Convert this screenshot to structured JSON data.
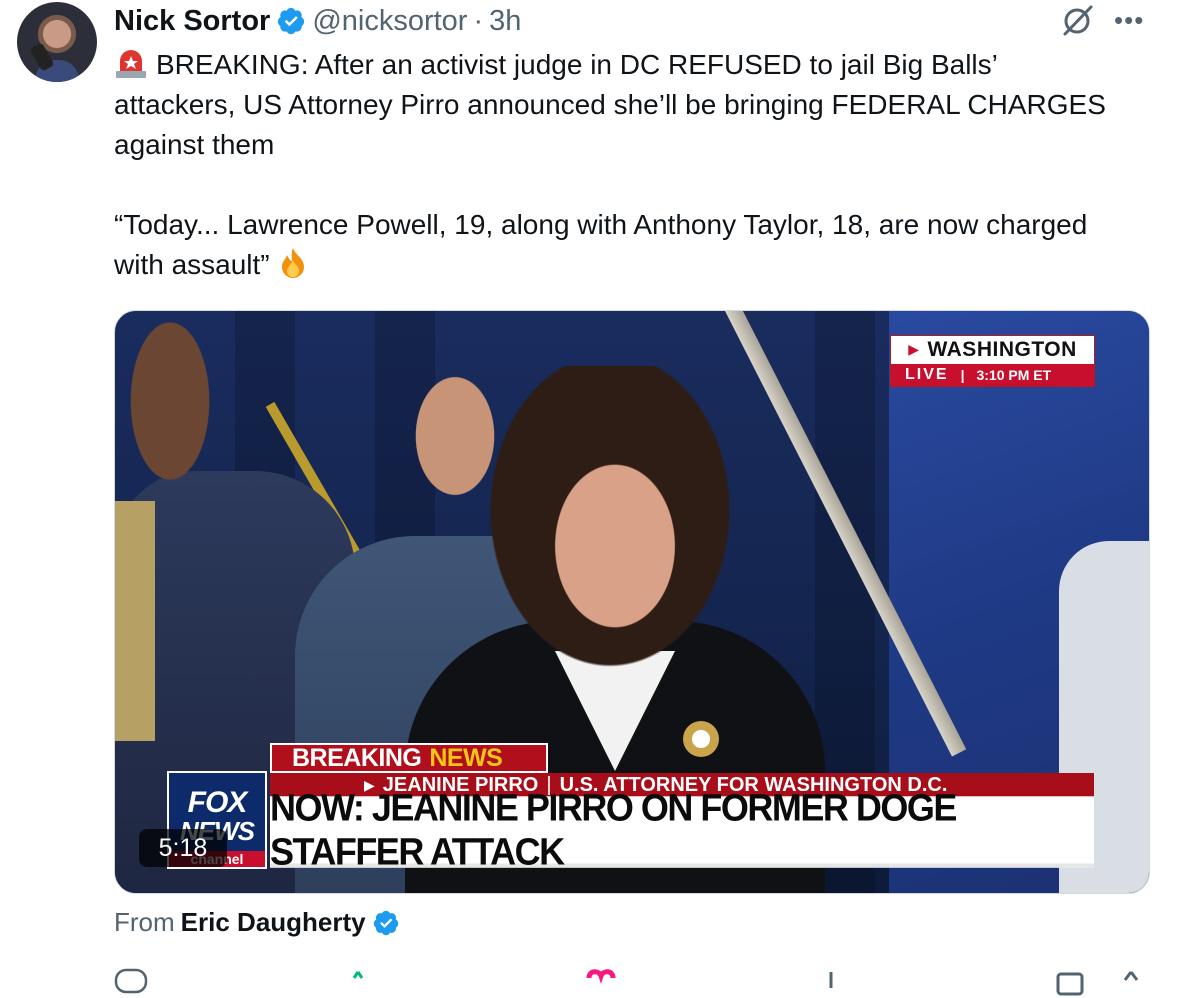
{
  "tweet": {
    "author_name": "Nick Sortor",
    "author_handle": "@nicksortor",
    "separator": "·",
    "time": "3h",
    "text_line1": "BREAKING: After an activist judge in DC REFUSED to jail Big Balls’ attackers, US Attorney Pirro announced she’ll be bringing FEDERAL CHARGES against them",
    "text_line2": "“Today... Lawrence Powell, 19, along with Anthony Taylor, 18, are now charged with assault”",
    "emoji_before": "siren-emoji",
    "emoji_after": "fire-emoji"
  },
  "video": {
    "location": "WASHINGTON",
    "live_label": "LIVE",
    "live_time": "3:10 PM ET",
    "breaking": "BREAKING",
    "news": "NEWS",
    "subline_name": "JEANINE PIRRO",
    "subline_sep": "|",
    "subline_title": "U.S. ATTORNEY FOR WASHINGTON D.C.",
    "headline": "NOW: JEANINE PIRRO ON FORMER DOGE STAFFER ATTACK",
    "logo_line1": "FOX",
    "logo_line2": "NEWS",
    "logo_line3": "channel",
    "duration": "5:18"
  },
  "attribution": {
    "prefix": "From",
    "author": "Eric Daugherty"
  },
  "colors": {
    "verified": "#1d9bf0",
    "muted_text": "#536471",
    "fox_red": "#c8102e",
    "fox_blue": "#0d2b6b"
  },
  "icons": [
    "grok-icon",
    "more-icon",
    "verified-badge-icon",
    "reply-icon",
    "repost-icon",
    "like-icon",
    "views-icon",
    "bookmark-icon",
    "share-icon"
  ]
}
